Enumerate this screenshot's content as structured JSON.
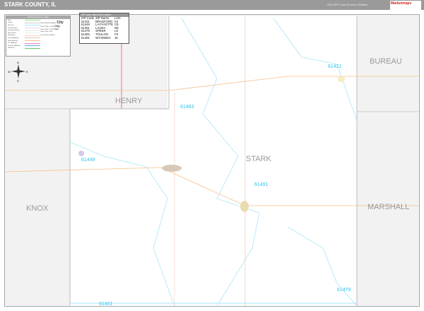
{
  "header": {
    "title": "STARK COUNTY, IL",
    "edition": "2023 ZIP Code Premium Edition",
    "logo": "Marketmaps"
  },
  "legend": {
    "title": "2023 Stark County, IL Map",
    "items": [
      {
        "label": "State",
        "color": "#9be89b"
      },
      {
        "label": "County",
        "color": "#cccccc"
      },
      {
        "label": "ZIP Code",
        "color": "#a9e6f7"
      },
      {
        "label": "Primary Streets",
        "color": "#dddddd"
      },
      {
        "label": "Secondary Streets",
        "color": "#e5e5e5"
      },
      {
        "label": "Minor Streets",
        "color": "#eeeeee"
      },
      {
        "label": "Rail Ramps",
        "color": "#f4d0c0"
      },
      {
        "label": "County Highways",
        "color": "#e8c0a8"
      },
      {
        "label": "State Highways",
        "color": "#f5c088"
      },
      {
        "label": "U.S. Highways",
        "color": "#f080c0"
      },
      {
        "label": "Interstate Highways",
        "color": "#60b0f0"
      },
      {
        "label": "Toll Roads",
        "color": "#60d060"
      }
    ],
    "cities": [
      "Cities 100,000 and Above",
      "Cities 25,000 - 99,999",
      "Cities 10,000 - 24,999",
      "Cities 1,000 - 9,999",
      "Cities 0-999 and Below"
    ],
    "city_samples": [
      "City",
      "City",
      "City"
    ]
  },
  "zip_index": {
    "title": "ZIP Code Index/Grid Locator",
    "headers": [
      "ZIP Code",
      "ZIP Name",
      "LOC"
    ],
    "rows": [
      [
        "61421",
        "BRADFORD",
        "K2"
      ],
      [
        "61449",
        "LA FAYETTE",
        "C5"
      ],
      [
        "61451",
        "LAURA",
        "D9"
      ],
      [
        "61479",
        "SPEER",
        "L8"
      ],
      [
        "61483",
        "TOULON",
        "F5"
      ],
      [
        "61491",
        "WYOMING",
        "J6"
      ]
    ]
  },
  "map": {
    "counties": [
      "HENRY",
      "BUREAU",
      "STARK",
      "KNOX",
      "MARSHALL"
    ],
    "zips": [
      "61421",
      "61483",
      "61449",
      "61491",
      "61479",
      "61451"
    ],
    "compass": [
      "N",
      "S",
      "E",
      "W"
    ],
    "colors": {
      "zip_line": "#2bc4ee",
      "us_highway": "#f080c0",
      "background": "#f2f2f2",
      "county_interior": "#ffffff"
    }
  }
}
